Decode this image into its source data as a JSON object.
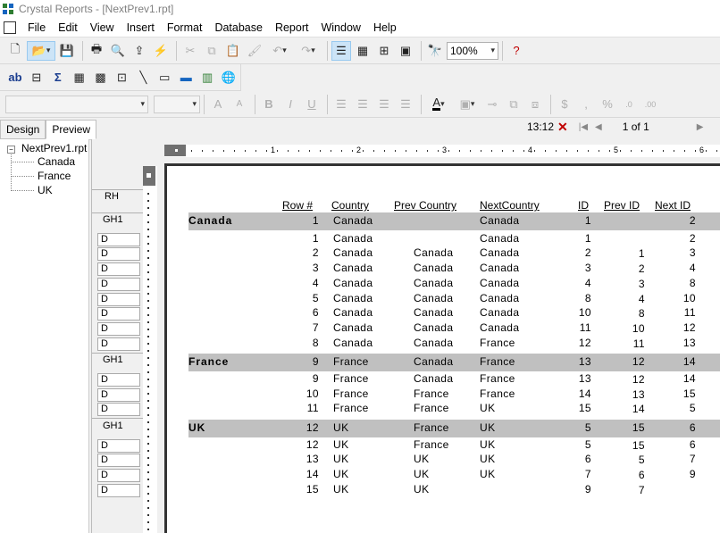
{
  "window": {
    "title": "Crystal Reports - [NextPrev1.rpt]"
  },
  "menu": [
    "File",
    "Edit",
    "View",
    "Insert",
    "Format",
    "Database",
    "Report",
    "Window",
    "Help"
  ],
  "toolbar": {
    "zoom": "100%"
  },
  "tabs": [
    "Design",
    "Preview"
  ],
  "nav": {
    "time": "13:12",
    "pages": "1 of 1"
  },
  "tree": {
    "root": "NextPrev1.rpt",
    "children": [
      "Canada",
      "France",
      "UK"
    ]
  },
  "sections": [
    "RH",
    "GH1",
    "D",
    "D",
    "D",
    "D",
    "D",
    "D",
    "D",
    "D",
    "GH1",
    "D",
    "D",
    "D",
    "GH1",
    "D",
    "D",
    "D",
    "D"
  ],
  "ruler": [
    "1",
    "2",
    "3",
    "4",
    "5",
    "6"
  ],
  "report": {
    "headers": [
      "Row #",
      "Country",
      "Prev Country",
      "NextCountry",
      "ID",
      "Prev ID",
      "Next ID"
    ],
    "rows": [
      {
        "type": "group",
        "name": "Canada",
        "cells": [
          "1",
          "Canada",
          "",
          "Canada",
          "1",
          "",
          "2"
        ]
      },
      {
        "type": "detail",
        "cells": [
          "1",
          "Canada",
          "",
          "Canada",
          "1",
          "",
          "2"
        ]
      },
      {
        "type": "detail",
        "cells": [
          "2",
          "Canada",
          "Canada",
          "Canada",
          "2",
          "1",
          "3"
        ]
      },
      {
        "type": "detail",
        "cells": [
          "3",
          "Canada",
          "Canada",
          "Canada",
          "3",
          "2",
          "4"
        ]
      },
      {
        "type": "detail",
        "cells": [
          "4",
          "Canada",
          "Canada",
          "Canada",
          "4",
          "3",
          "8"
        ]
      },
      {
        "type": "detail",
        "cells": [
          "5",
          "Canada",
          "Canada",
          "Canada",
          "8",
          "4",
          "10"
        ]
      },
      {
        "type": "detail",
        "cells": [
          "6",
          "Canada",
          "Canada",
          "Canada",
          "10",
          "8",
          "11"
        ]
      },
      {
        "type": "detail",
        "cells": [
          "7",
          "Canada",
          "Canada",
          "Canada",
          "11",
          "10",
          "12"
        ]
      },
      {
        "type": "detail",
        "cells": [
          "8",
          "Canada",
          "Canada",
          "France",
          "12",
          "11",
          "13"
        ]
      },
      {
        "type": "group",
        "name": "France",
        "cells": [
          "9",
          "France",
          "Canada",
          "France",
          "13",
          "12",
          "14"
        ]
      },
      {
        "type": "detail",
        "cells": [
          "9",
          "France",
          "Canada",
          "France",
          "13",
          "12",
          "14"
        ]
      },
      {
        "type": "detail",
        "cells": [
          "10",
          "France",
          "France",
          "France",
          "14",
          "13",
          "15"
        ]
      },
      {
        "type": "detail",
        "cells": [
          "11",
          "France",
          "France",
          "UK",
          "15",
          "14",
          "5"
        ]
      },
      {
        "type": "group",
        "name": "UK",
        "cells": [
          "12",
          "UK",
          "France",
          "UK",
          "5",
          "15",
          "6"
        ]
      },
      {
        "type": "detail",
        "cells": [
          "12",
          "UK",
          "France",
          "UK",
          "5",
          "15",
          "6"
        ]
      },
      {
        "type": "detail",
        "cells": [
          "13",
          "UK",
          "UK",
          "UK",
          "6",
          "5",
          "7"
        ]
      },
      {
        "type": "detail",
        "cells": [
          "14",
          "UK",
          "UK",
          "UK",
          "7",
          "6",
          "9"
        ]
      },
      {
        "type": "detail",
        "cells": [
          "15",
          "UK",
          "UK",
          "",
          "9",
          "7",
          ""
        ]
      }
    ]
  },
  "colors": {
    "band": "#c0c0c0",
    "accent_red": "#c00000"
  }
}
